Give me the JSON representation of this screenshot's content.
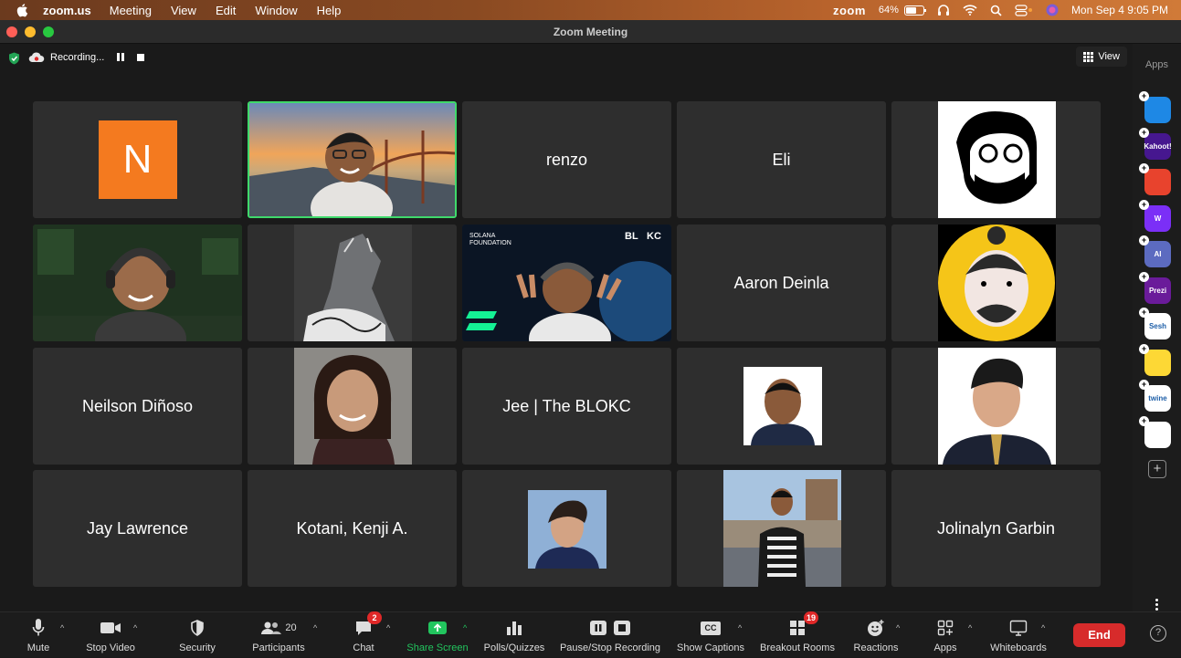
{
  "menubar": {
    "app": "zoom.us",
    "items": [
      "Meeting",
      "View",
      "Edit",
      "Window",
      "Help"
    ],
    "status_logo": "zoom",
    "battery": "64%",
    "battery_level": 0.64,
    "datetime": "Mon Sep 4  9:05 PM"
  },
  "window": {
    "title": "Zoom Meeting"
  },
  "topbar": {
    "recording_label": "Recording...",
    "view_label": "View"
  },
  "apps_rail": {
    "title": "Apps",
    "apps": [
      {
        "name": "pitch-app-icon",
        "text": "",
        "color": "#1e88e5"
      },
      {
        "name": "kahoot-app-icon",
        "text": "Kahoot!",
        "color": "#46178f"
      },
      {
        "name": "red-app-icon",
        "text": "",
        "color": "#e8432d"
      },
      {
        "name": "wooclap-app-icon",
        "text": "W",
        "color": "#7b2ff7"
      },
      {
        "name": "ai-app-icon",
        "text": "AI",
        "color": "#5c6bc0"
      },
      {
        "name": "prezi-app-icon",
        "text": "Prezi",
        "color": "#6a1b9a"
      },
      {
        "name": "sesh-app-icon",
        "text": "Sesh",
        "color": "#ffffff"
      },
      {
        "name": "smile-app-icon",
        "text": "",
        "color": "#fdd835"
      },
      {
        "name": "twine-app-icon",
        "text": "twine",
        "color": "#ffffff"
      },
      {
        "name": "multi-app-icon",
        "text": "",
        "color": "#ffffff"
      }
    ]
  },
  "participants": [
    {
      "name": "N",
      "type": "avatar"
    },
    {
      "name": "",
      "type": "video"
    },
    {
      "name": "renzo",
      "type": "name"
    },
    {
      "name": "Eli",
      "type": "name"
    },
    {
      "name": "",
      "type": "image"
    },
    {
      "name": "",
      "type": "video"
    },
    {
      "name": "",
      "type": "image"
    },
    {
      "name": "",
      "type": "video",
      "overlay": [
        "SOLANA",
        "FOUNDATION",
        "BL",
        "KC"
      ]
    },
    {
      "name": "Aaron Deinla",
      "type": "name"
    },
    {
      "name": "",
      "type": "image"
    },
    {
      "name": "Neilson Diñoso",
      "type": "name"
    },
    {
      "name": "",
      "type": "image"
    },
    {
      "name": "Jee | The BLOKC",
      "type": "name"
    },
    {
      "name": "",
      "type": "image"
    },
    {
      "name": "",
      "type": "image"
    },
    {
      "name": "Jay Lawrence",
      "type": "name"
    },
    {
      "name": "Kotani, Kenji A.",
      "type": "name"
    },
    {
      "name": "",
      "type": "image"
    },
    {
      "name": "",
      "type": "image"
    },
    {
      "name": "Jolinalyn Garbin",
      "type": "name"
    }
  ],
  "toolbar": {
    "mute": "Mute",
    "stop_video": "Stop Video",
    "security": "Security",
    "participants": "Participants",
    "participants_count": "20",
    "chat": "Chat",
    "chat_badge": "2",
    "share_screen": "Share Screen",
    "polls": "Polls/Quizzes",
    "recording": "Pause/Stop Recording",
    "captions": "Show Captions",
    "captions_icon": "CC",
    "breakout": "Breakout Rooms",
    "breakout_badge": "19",
    "reactions": "Reactions",
    "apps": "Apps",
    "whiteboards": "Whiteboards",
    "end": "End",
    "help_glyph": "?"
  }
}
